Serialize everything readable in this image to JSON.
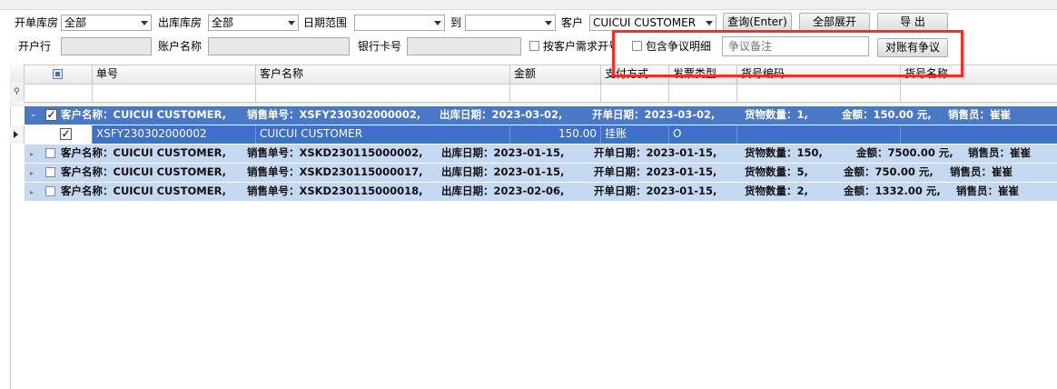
{
  "toolbar": {
    "row1": {
      "billing_warehouse_label": "开单库房",
      "billing_warehouse_value": "全部",
      "outbound_warehouse_label": "出库库房",
      "outbound_warehouse_value": "全部",
      "date_range_label": "日期范围",
      "date_from_value": "",
      "to_label": "到",
      "date_to_value": "",
      "customer_label": "客户",
      "customer_value": "CUICUI CUSTOMER",
      "query_button": "查询(Enter)",
      "expand_all_button": "全部展开",
      "export_button": "导 出"
    },
    "row2": {
      "bank_label": "开户行",
      "account_name_label": "账户名称",
      "bank_card_label": "银行卡号",
      "by_customer_label": "按客户需求开号",
      "include_dispute_label": "包含争议明细",
      "dispute_note_placeholder": "争议备注",
      "dispute_button": "对账有争议"
    }
  },
  "grid": {
    "columns": [
      "单号",
      "客户名称",
      "金额",
      "支付方式",
      "发票类型",
      "货号编码",
      "货号名称"
    ],
    "groups": [
      {
        "customer": "客户名称：CUICUI CUSTOMER,",
        "order": "销售单号：XSFY230302000002,",
        "out_date": "出库日期：2023-03-02,",
        "bill_date": "开单日期：2023-03-02,",
        "qty": "货物数量：1,",
        "amount": "金额：150.00 元,",
        "seller": "销售员：崔崔",
        "checked": true,
        "expanded": true
      },
      {
        "customer": "客户名称：CUICUI CUSTOMER,",
        "order": "销售单号：XSKD230115000002,",
        "out_date": "出库日期：2023-01-15,",
        "bill_date": "开单日期：2023-01-15,",
        "qty": "货物数量：150,",
        "amount": "金额：7500.00 元,",
        "seller": "销售员：崔崔",
        "checked": false,
        "expanded": false
      },
      {
        "customer": "客户名称：CUICUI CUSTOMER,",
        "order": "销售单号：XSKD230115000017,",
        "out_date": "出库日期：2023-01-15,",
        "bill_date": "开单日期：2023-01-15,",
        "qty": "货物数量：5,",
        "amount": "金额：750.00 元,",
        "seller": "销售员：崔崔",
        "checked": false,
        "expanded": false
      },
      {
        "customer": "客户名称：CUICUI CUSTOMER,",
        "order": "销售单号：XSKD230115000018,",
        "out_date": "出库日期：2023-02-06,",
        "bill_date": "开单日期：2023-01-15,",
        "qty": "货物数量：2,",
        "amount": "金额：1332.00 元,",
        "seller": "销售员：崔崔",
        "checked": false,
        "expanded": false
      }
    ],
    "detail_row": {
      "order_no": "XSFY230302000002",
      "customer": "CUICUI CUSTOMER",
      "amount": "150.00",
      "payment": "挂账",
      "invoice": "O",
      "checked": true
    }
  },
  "colors": {
    "group_row": "#c5d8f2",
    "group_row_selected": "#4a78c4",
    "detail_row_selected": "#3d70c8",
    "highlight_box": "#ff2b2b"
  }
}
